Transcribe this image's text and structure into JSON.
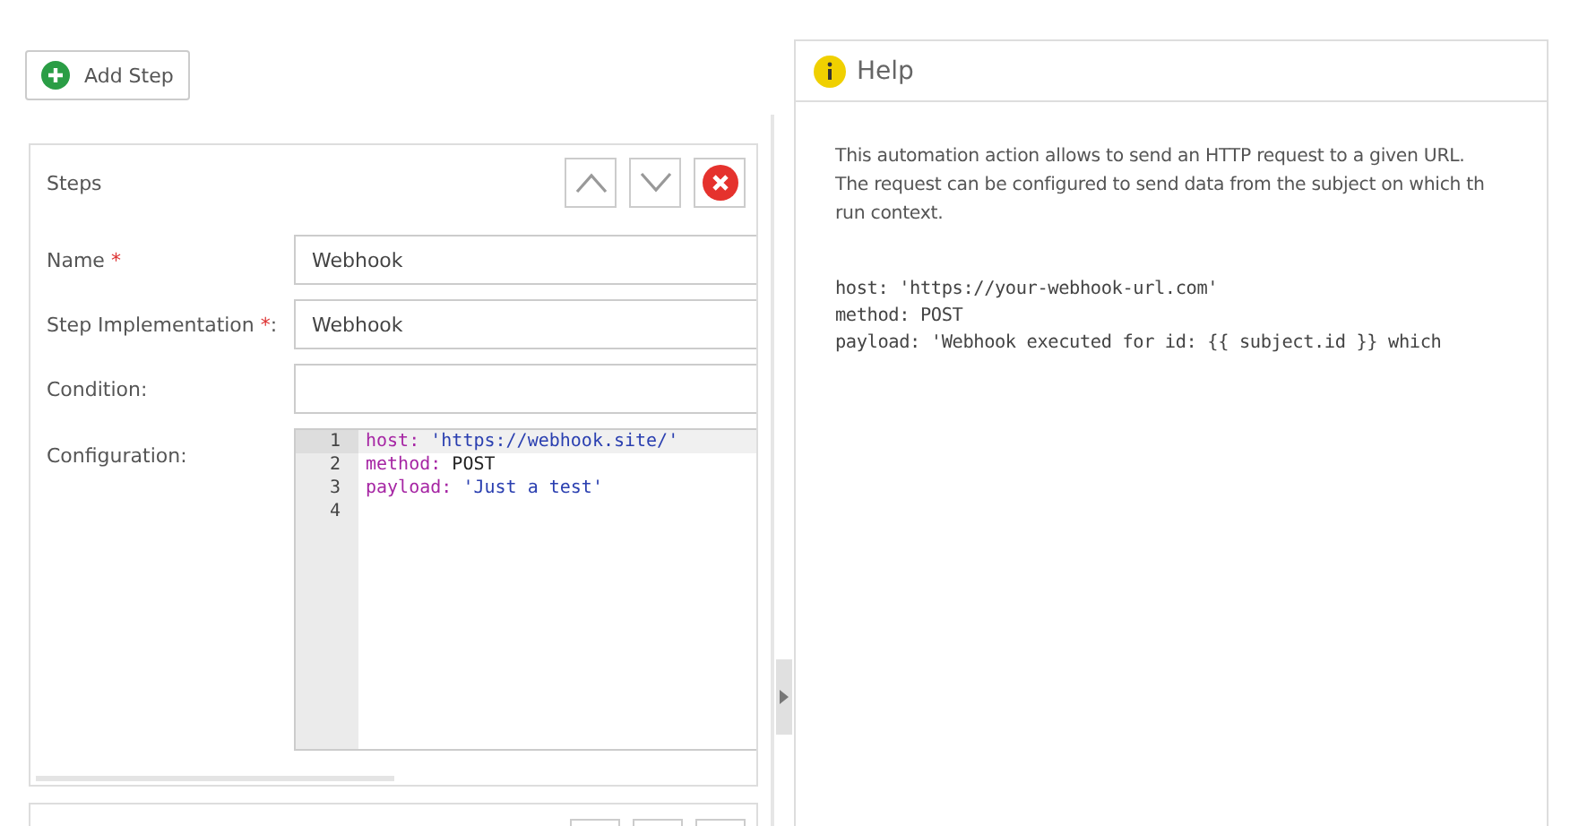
{
  "toolbar": {
    "add_button": "Add Step"
  },
  "step_card": {
    "title": "Steps",
    "fields": [
      {
        "label": "Name",
        "required_mark": "*",
        "value": "Webhook"
      },
      {
        "label": "Step Implementation",
        "required_mark": "*",
        "suffix": ":",
        "value": "Webhook"
      },
      {
        "label": "Condition:"
      }
    ],
    "configuration": {
      "label": "Configuration:",
      "lines": [
        {
          "number": "1",
          "active": true,
          "segments": [
            {
              "kind": "key",
              "text": "host:"
            },
            {
              "kind": "string",
              "text": " 'https://webhook.site/'"
            }
          ]
        },
        {
          "number": "2",
          "active": false,
          "segments": [
            {
              "kind": "key",
              "text": "method:"
            },
            {
              "kind": "plain",
              "text": " POST"
            }
          ]
        },
        {
          "number": "3",
          "active": false,
          "segments": [
            {
              "kind": "key",
              "text": "payload:"
            },
            {
              "kind": "string",
              "text": " 'Just a test'"
            }
          ]
        },
        {
          "number": "4",
          "active": false
        }
      ]
    }
  },
  "help": {
    "title": "Help",
    "paragraph": [
      "This automation action allows to send an HTTP request to a given URL.",
      "The request can be configured to send data from the subject on which th",
      "run context."
    ],
    "code": [
      "host: 'https://your-webhook-url.com'",
      "method: POST",
      "payload: 'Webhook executed for id: {{ subject.id }} which"
    ]
  }
}
